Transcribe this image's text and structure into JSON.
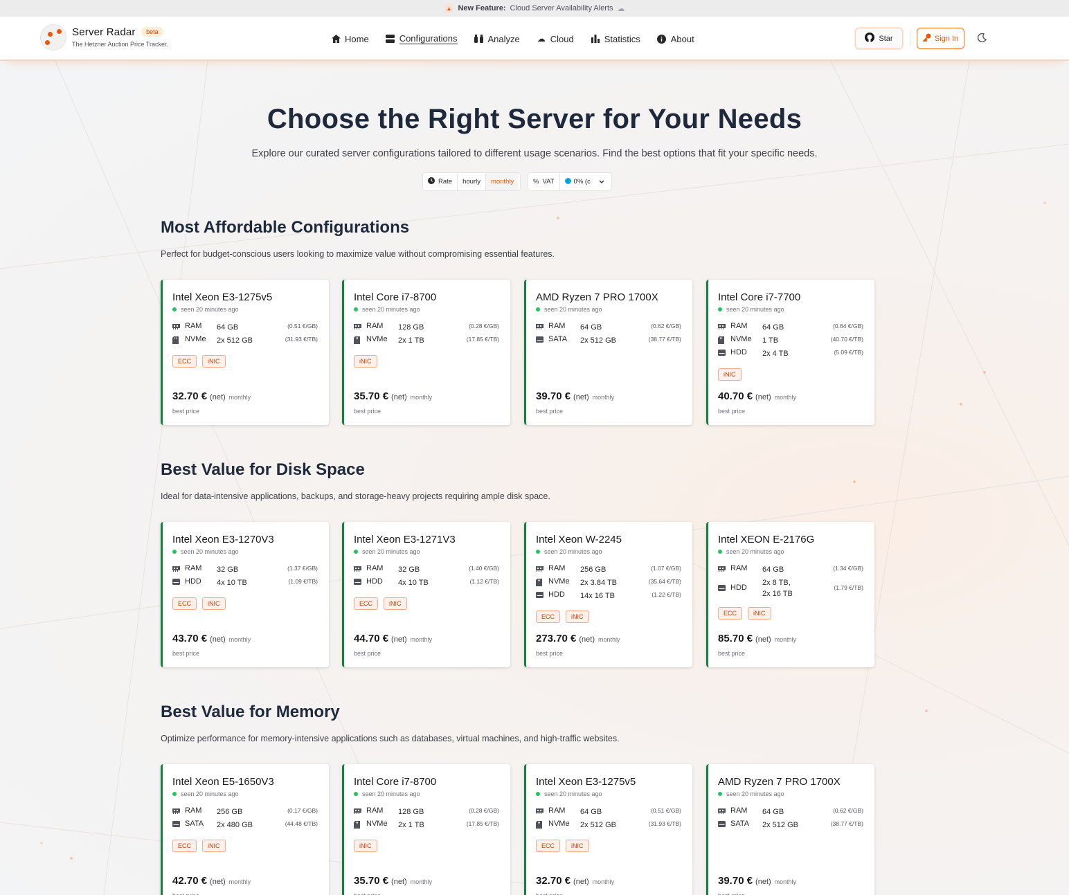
{
  "announcement": {
    "label": "New Feature:",
    "text": "Cloud Server Availability Alerts"
  },
  "header": {
    "brand": "Server Radar",
    "badge": "beta",
    "tagline": "The Hetzner Auction Price Tracker.",
    "nav": [
      {
        "label": "Home",
        "icon": "home-icon"
      },
      {
        "label": "Configurations",
        "icon": "server-icon",
        "active": true
      },
      {
        "label": "Analyze",
        "icon": "binoculars-icon"
      },
      {
        "label": "Cloud",
        "icon": "cloud-icon"
      },
      {
        "label": "Statistics",
        "icon": "bar-chart-icon"
      },
      {
        "label": "About",
        "icon": "info-icon"
      }
    ],
    "star_label": "Star",
    "signin_label": "Sign In"
  },
  "hero": {
    "title": "Choose the Right Server for Your Needs",
    "subtitle": "Explore our curated server configurations tailored to different usage scenarios. Find the best options that fit your specific needs.",
    "rate_label": "Rate",
    "rate_options": [
      "hourly",
      "monthly"
    ],
    "rate_selected": "monthly",
    "vat_label": "VAT",
    "vat_value": "0% (c"
  },
  "common": {
    "seen": "seen 20 minutes ago",
    "net": "(net)",
    "period": "monthly",
    "best_price": "best price"
  },
  "sections": [
    {
      "title": "Most Affordable Configurations",
      "description": "Perfect for budget-conscious users looking to maximize value without compromising essential features.",
      "cards": [
        {
          "name": "Intel Xeon E3-1275v5",
          "specs": [
            {
              "type": "RAM",
              "value": "64 GB",
              "per": "(0.51 €/GB)"
            },
            {
              "type": "NVMe",
              "value": "2x 512 GB",
              "per": "(31.93 €/TB)"
            }
          ],
          "badges": [
            "ECC",
            "iNIC"
          ],
          "price": "32.70 €"
        },
        {
          "name": "Intel Core i7-8700",
          "specs": [
            {
              "type": "RAM",
              "value": "128 GB",
              "per": "(0.28 €/GB)"
            },
            {
              "type": "NVMe",
              "value": "2x 1 TB",
              "per": "(17.85 €/TB)"
            }
          ],
          "badges": [
            "iNIC"
          ],
          "price": "35.70 €"
        },
        {
          "name": "AMD Ryzen 7 PRO 1700X",
          "specs": [
            {
              "type": "RAM",
              "value": "64 GB",
              "per": "(0.62 €/GB)"
            },
            {
              "type": "SATA",
              "value": "2x 512 GB",
              "per": "(38.77 €/TB)"
            }
          ],
          "badges": [],
          "price": "39.70 €"
        },
        {
          "name": "Intel Core i7-7700",
          "specs": [
            {
              "type": "RAM",
              "value": "64 GB",
              "per": "(0.64 €/GB)"
            },
            {
              "type": "NVMe",
              "value": "1 TB",
              "per": "(40.70 €/TB)"
            },
            {
              "type": "HDD",
              "value": "2x 4 TB",
              "per": "(5.09 €/TB)"
            }
          ],
          "badges": [
            "iNIC"
          ],
          "price": "40.70 €"
        }
      ]
    },
    {
      "title": "Best Value for Disk Space",
      "description": "Ideal for data-intensive applications, backups, and storage-heavy projects requiring ample disk space.",
      "cards": [
        {
          "name": "Intel Xeon E3-1270V3",
          "specs": [
            {
              "type": "RAM",
              "value": "32 GB",
              "per": "(1.37 €/GB)"
            },
            {
              "type": "HDD",
              "value": "4x 10 TB",
              "per": "(1.09 €/TB)"
            }
          ],
          "badges": [
            "ECC",
            "iNIC"
          ],
          "price": "43.70 €"
        },
        {
          "name": "Intel Xeon E3-1271V3",
          "specs": [
            {
              "type": "RAM",
              "value": "32 GB",
              "per": "(1.40 €/GB)"
            },
            {
              "type": "HDD",
              "value": "4x 10 TB",
              "per": "(1.12 €/TB)"
            }
          ],
          "badges": [
            "ECC",
            "iNIC"
          ],
          "price": "44.70 €"
        },
        {
          "name": "Intel Xeon W-2245",
          "specs": [
            {
              "type": "RAM",
              "value": "256 GB",
              "per": "(1.07 €/GB)"
            },
            {
              "type": "NVMe",
              "value": "2x 3.84 TB",
              "per": "(35.64 €/TB)"
            },
            {
              "type": "HDD",
              "value": "14x 16 TB",
              "per": "(1.22 €/TB)"
            }
          ],
          "badges": [
            "ECC",
            "iNIC"
          ],
          "price": "273.70 €"
        },
        {
          "name": "Intel XEON E-2176G",
          "specs": [
            {
              "type": "RAM",
              "value": "64 GB",
              "per": "(1.34 €/GB)"
            },
            {
              "type": "HDD",
              "value": "2x 8 TB,",
              "value2": "2x 16 TB",
              "per": "(1.79 €/TB)"
            }
          ],
          "badges": [
            "ECC",
            "iNIC"
          ],
          "price": "85.70 €"
        }
      ]
    },
    {
      "title": "Best Value for Memory",
      "description": "Optimize performance for memory-intensive applications such as databases, virtual machines, and high-traffic websites.",
      "cards": [
        {
          "name": "Intel Xeon E5-1650V3",
          "specs": [
            {
              "type": "RAM",
              "value": "256 GB",
              "per": "(0.17 €/GB)"
            },
            {
              "type": "SATA",
              "value": "2x 480 GB",
              "per": "(44.48 €/TB)"
            }
          ],
          "badges": [
            "ECC",
            "iNIC"
          ],
          "price": "42.70 €"
        },
        {
          "name": "Intel Core i7-8700",
          "specs": [
            {
              "type": "RAM",
              "value": "128 GB",
              "per": "(0.28 €/GB)"
            },
            {
              "type": "NVMe",
              "value": "2x 1 TB",
              "per": "(17.85 €/TB)"
            }
          ],
          "badges": [
            "iNIC"
          ],
          "price": "35.70 €"
        },
        {
          "name": "Intel Xeon E3-1275v5",
          "specs": [
            {
              "type": "RAM",
              "value": "64 GB",
              "per": "(0.51 €/GB)"
            },
            {
              "type": "NVMe",
              "value": "2x 512 GB",
              "per": "(31.93 €/TB)"
            }
          ],
          "badges": [
            "ECC",
            "iNIC"
          ],
          "price": "32.70 €"
        },
        {
          "name": "AMD Ryzen 7 PRO 1700X",
          "specs": [
            {
              "type": "RAM",
              "value": "64 GB",
              "per": "(0.62 €/GB)"
            },
            {
              "type": "SATA",
              "value": "2x 512 GB",
              "per": "(38.77 €/TB)"
            }
          ],
          "badges": [],
          "price": "39.70 €"
        }
      ]
    }
  ]
}
